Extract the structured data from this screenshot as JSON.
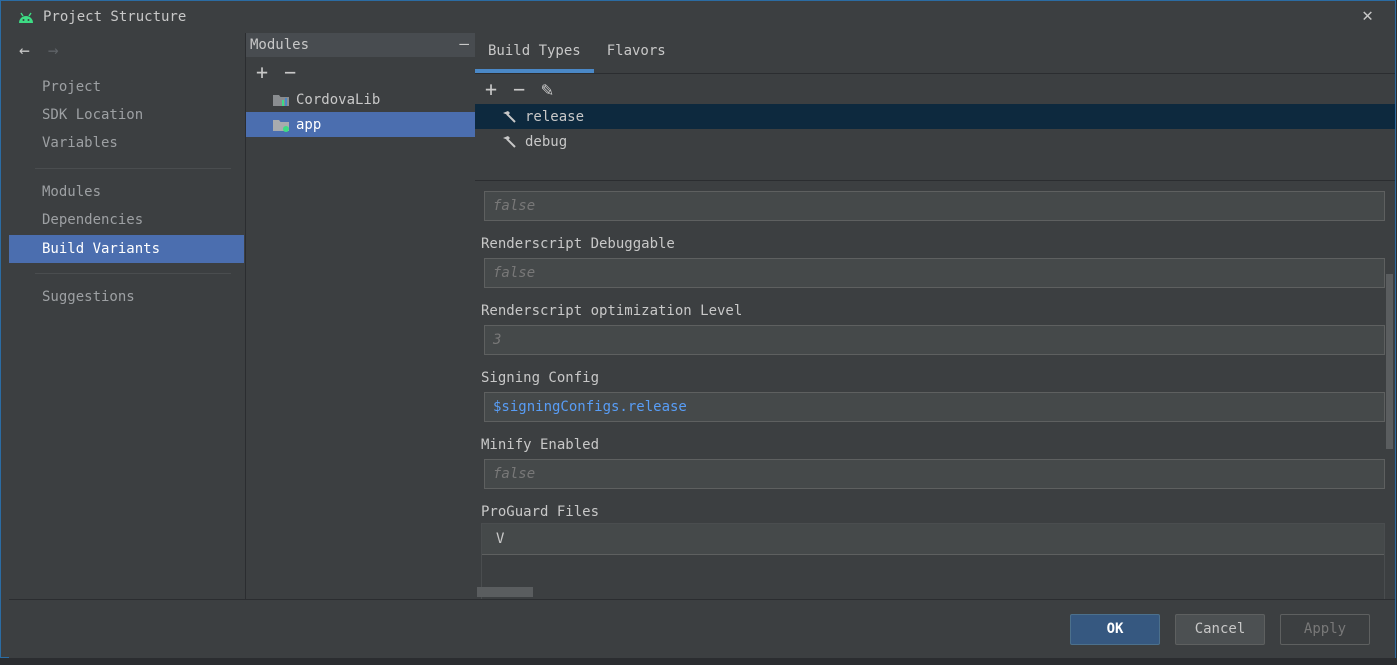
{
  "window": {
    "title": "Project Structure",
    "close_label": "✕"
  },
  "nav": {
    "back": "←",
    "forward": "→",
    "items": [
      {
        "label": "Project"
      },
      {
        "label": "SDK Location"
      },
      {
        "label": "Variables"
      },
      {
        "label": "Modules"
      },
      {
        "label": "Dependencies"
      },
      {
        "label": "Build Variants"
      },
      {
        "label": "Suggestions"
      }
    ],
    "selected": "Build Variants"
  },
  "modules": {
    "header": "Modules",
    "collapse": "—",
    "add": "+",
    "remove": "−",
    "items": [
      {
        "label": "CordovaLib"
      },
      {
        "label": "app"
      }
    ],
    "selected": "app"
  },
  "tabs": [
    {
      "label": "Build Types"
    },
    {
      "label": "Flavors"
    }
  ],
  "active_tab": "Build Types",
  "build_types": {
    "add": "+",
    "remove": "−",
    "edit": "✎",
    "items": [
      {
        "label": "release"
      },
      {
        "label": "debug"
      }
    ],
    "selected": "release"
  },
  "properties": [
    {
      "label": "Renderscript Debuggable",
      "value": "false"
    },
    {
      "label": "Renderscript optimization Level",
      "value": "3"
    },
    {
      "label": "Signing Config",
      "value": "$signingConfigs.release"
    },
    {
      "label": "Minify Enabled",
      "value": "false"
    }
  ],
  "partial_field": {
    "value": "false"
  },
  "proguard": {
    "label": "ProGuard Files",
    "row_value": "V"
  },
  "footer": {
    "ok": "OK",
    "cancel": "Cancel",
    "apply": "Apply"
  },
  "colors": {
    "selection": "#4b6eaf",
    "link": "#589df6",
    "ok_button": "#365880",
    "android_green": "#3ddc84"
  }
}
